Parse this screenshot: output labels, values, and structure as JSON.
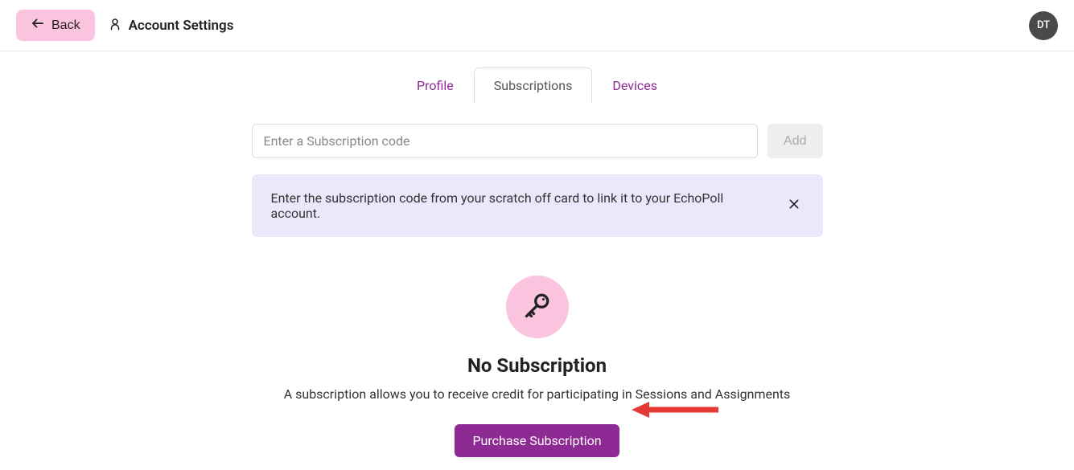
{
  "header": {
    "back_label": "Back",
    "page_title": "Account Settings",
    "avatar_initials": "DT"
  },
  "tabs": {
    "profile": "Profile",
    "subscriptions": "Subscriptions",
    "devices": "Devices"
  },
  "content": {
    "input_placeholder": "Enter a Subscription code",
    "add_label": "Add",
    "banner_text": "Enter the subscription code from your scratch off card to link it to your EchoPoll account.",
    "empty_title": "No Subscription",
    "empty_desc": "A subscription allows you to receive credit for participating in Sessions and Assignments",
    "purchase_label": "Purchase Subscription"
  }
}
